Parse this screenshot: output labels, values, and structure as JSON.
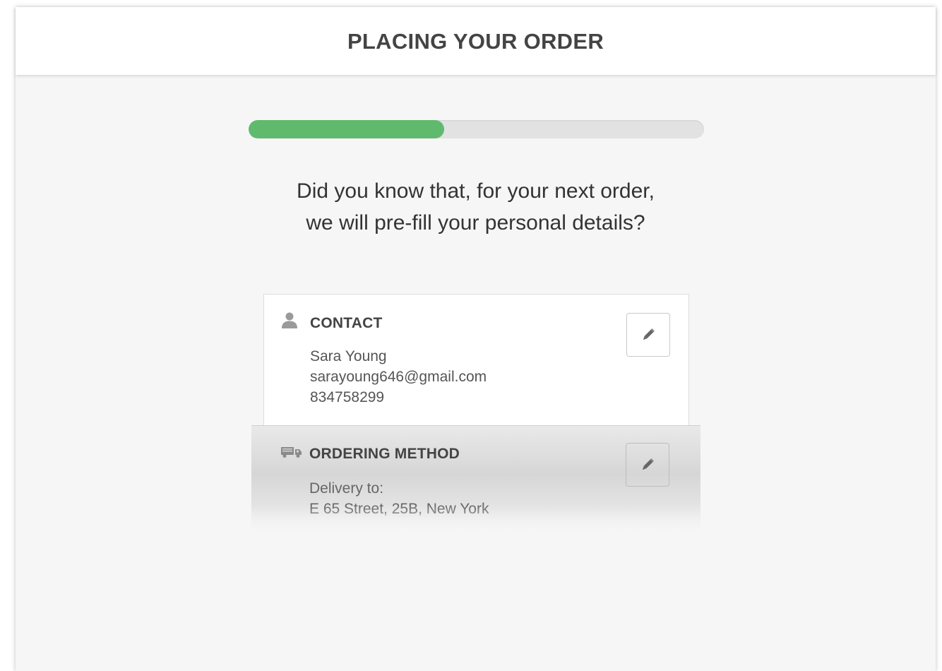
{
  "header": {
    "title": "PLACING YOUR ORDER"
  },
  "progress": {
    "value": 0.43,
    "fill_color": "#5fba6e",
    "track_color": "#e2e2e2"
  },
  "tip": {
    "line1": "Did you know that, for your next order,",
    "line2": "we will pre-fill your personal details?"
  },
  "contact": {
    "icon": "person-icon",
    "title": "CONTACT",
    "name": "Sara Young",
    "email": "sarayoung646@gmail.com",
    "phone": "834758299",
    "edit_icon": "pencil-icon"
  },
  "ordering_method": {
    "icon": "delivery-truck-icon",
    "title": "ORDERING METHOD",
    "label": "Delivery to:",
    "address": "E 65 Street, 25B, New York",
    "edit_icon": "pencil-icon"
  }
}
